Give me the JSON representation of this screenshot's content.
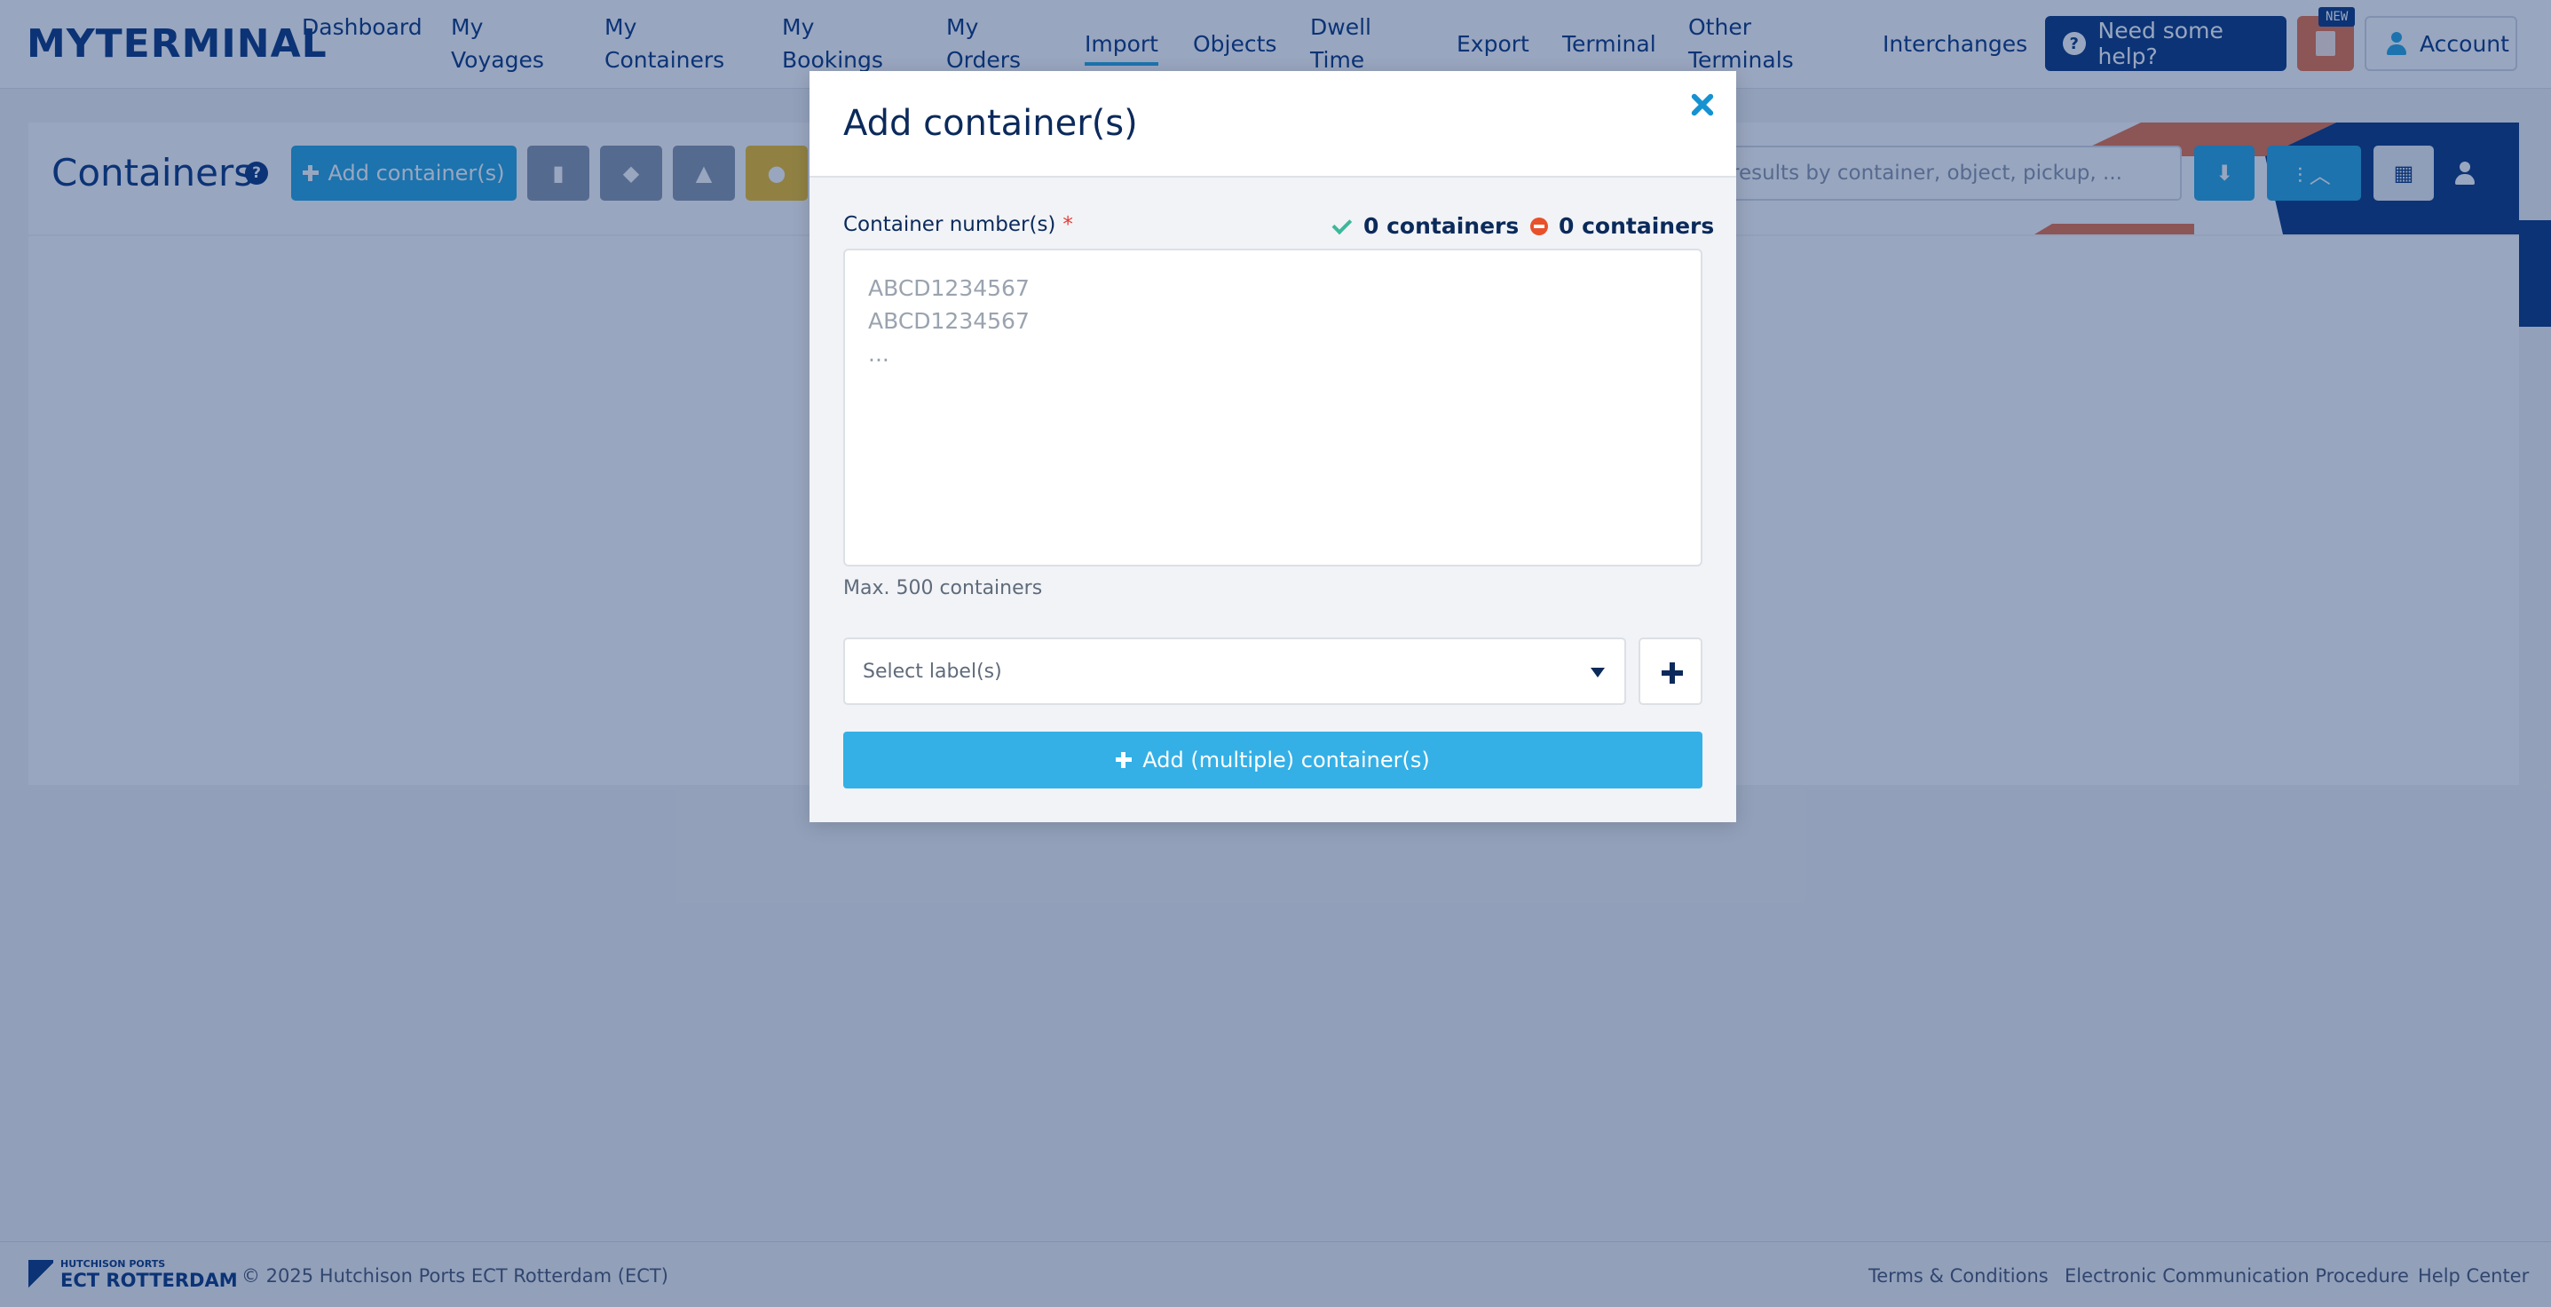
{
  "header": {
    "logo": "MYTERMINAL",
    "nav": [
      {
        "label": "Dashboard",
        "active": false
      },
      {
        "label": "My\nVoyages",
        "active": false
      },
      {
        "label": "My\nContainers",
        "active": false
      },
      {
        "label": "My\nBookings",
        "active": false
      },
      {
        "label": "My\nOrders",
        "active": false
      },
      {
        "label": "Import",
        "active": true
      },
      {
        "label": "Objects",
        "active": false
      },
      {
        "label": "Dwell\nTime",
        "active": false
      },
      {
        "label": "Export",
        "active": false
      },
      {
        "label": "Terminal",
        "active": false
      },
      {
        "label": "Other\nTerminals",
        "active": false
      },
      {
        "label": "Interchanges",
        "active": false
      }
    ],
    "help_label": "Need some help?",
    "new_badge": "NEW",
    "account_label": "Account"
  },
  "toolbar": {
    "title": "Containers",
    "help_icon": "?",
    "add_label": "Add container(s)",
    "search_placeholder": "results by container, object, pickup, ..."
  },
  "modal": {
    "title": "Add container(s)",
    "field_label": "Container number(s)",
    "required_mark": "*",
    "valid_count": "0 containers",
    "invalid_count": "0 containers",
    "textarea_placeholder": "ABCD1234567\nABCD1234567\n...",
    "hint": "Max. 500 containers",
    "select_placeholder": "Select label(s)",
    "submit_label": "Add (multiple) container(s)"
  },
  "footer": {
    "logo_top": "HUTCHISON PORTS",
    "logo_bottom": "ECT ROTTERDAM",
    "copyright": "© 2025 Hutchison Ports ECT Rotterdam (ECT)",
    "links": [
      "Terms & Conditions",
      "Electronic Communication Procedure",
      "Help Center"
    ]
  },
  "colors": {
    "navy": "#0b3a82",
    "accent_blue": "#29a8e0",
    "orange": "#e8744a",
    "overlay": "rgba(11,42,102,0.42)"
  }
}
